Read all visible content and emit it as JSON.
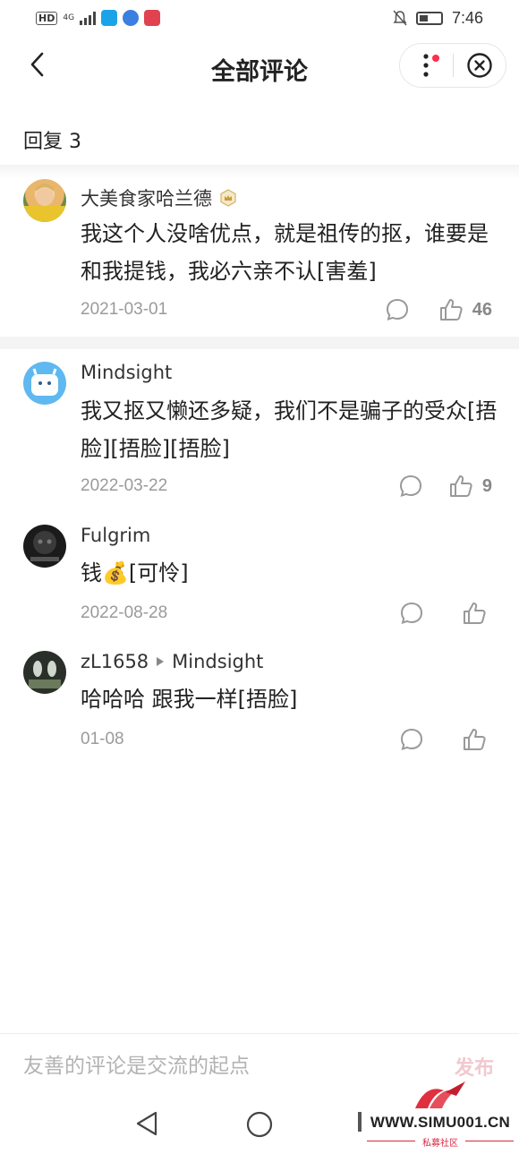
{
  "status_bar": {
    "hd": "HD",
    "network": "4G",
    "time": "7:46"
  },
  "header": {
    "title": "全部评论",
    "back_icon": "chevron-left-icon",
    "more_icon": "more-vertical-icon",
    "close_icon": "close-circle-icon"
  },
  "reply_count": "回复 3",
  "comments": [
    {
      "author": "大美食家哈兰德",
      "badge_icon": "crown-badge-icon",
      "text": "我这个人没啥优点，就是祖传的抠，谁要是和我提钱，我必六亲不认[害羞]",
      "date": "2021-03-01",
      "likes": "46"
    },
    {
      "author": "Mindsight",
      "text": "我又抠又懒还多疑，我们不是骗子的受众[捂脸][捂脸][捂脸]",
      "date": "2022-03-22",
      "likes": "9"
    },
    {
      "author": "Fulgrim",
      "text_before": "钱",
      "emoji": "💰",
      "text_after": "[可怜]",
      "date": "2022-08-28",
      "likes": ""
    },
    {
      "author": "zL1658",
      "reply_to": "Mindsight",
      "text": "哈哈哈 跟我一样[捂脸]",
      "date": "01-08",
      "likes": ""
    }
  ],
  "input_bar": {
    "placeholder": "友善的评论是交流的起点",
    "publish_label": "发布"
  },
  "watermark": {
    "text": "WWW.SIMU001.CN",
    "sub": "私募社区"
  },
  "colors": {
    "accent_red": "#ff2d4a",
    "muted_text": "#9a9a9a",
    "publish_disabled": "#f0c9cf"
  }
}
